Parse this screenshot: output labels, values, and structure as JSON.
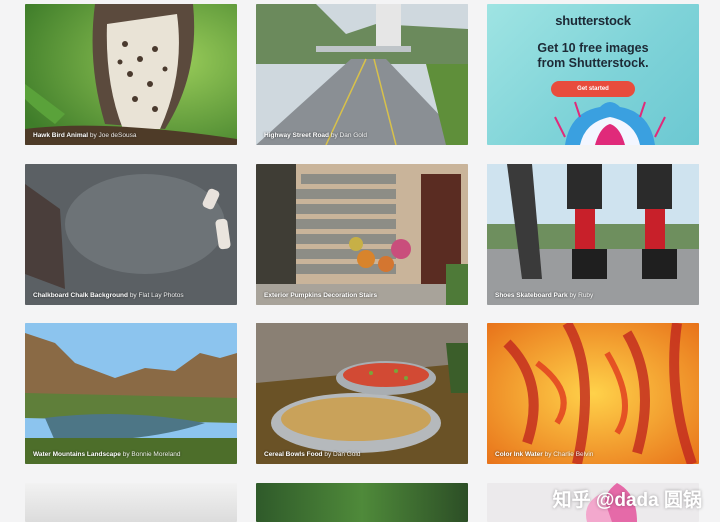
{
  "tiles": [
    {
      "title": "Hawk Bird Animal",
      "author": "Joe deSousa"
    },
    {
      "title": "Highway Street Road",
      "author": "Dan Gold"
    },
    {
      "title": "Chalkboard Chalk Background",
      "author": "Flat Lay Photos"
    },
    {
      "title": "Exterior Pumpkins Decoration Stairs",
      "author": ""
    },
    {
      "title": "Shoes Skateboard Park",
      "author": "Ruby"
    },
    {
      "title": "Water Mountains Landscape",
      "author": "Bonnie Moreland"
    },
    {
      "title": "Cereal Bowls Food",
      "author": "Dan Gold"
    },
    {
      "title": "Color Ink Water",
      "author": "Charlie Belvin"
    }
  ],
  "ad": {
    "brand": "shutterstock",
    "headline_line1": "Get 10 free images",
    "headline_line2": "from Shutterstock.",
    "cta": "Get started"
  },
  "by_word": "by",
  "watermark": "知乎 @dada 圆锅",
  "colors": {
    "cta": "#e84c3d",
    "ad_bg": "#7fd3d8",
    "page_bg": "#f4f4f5"
  }
}
